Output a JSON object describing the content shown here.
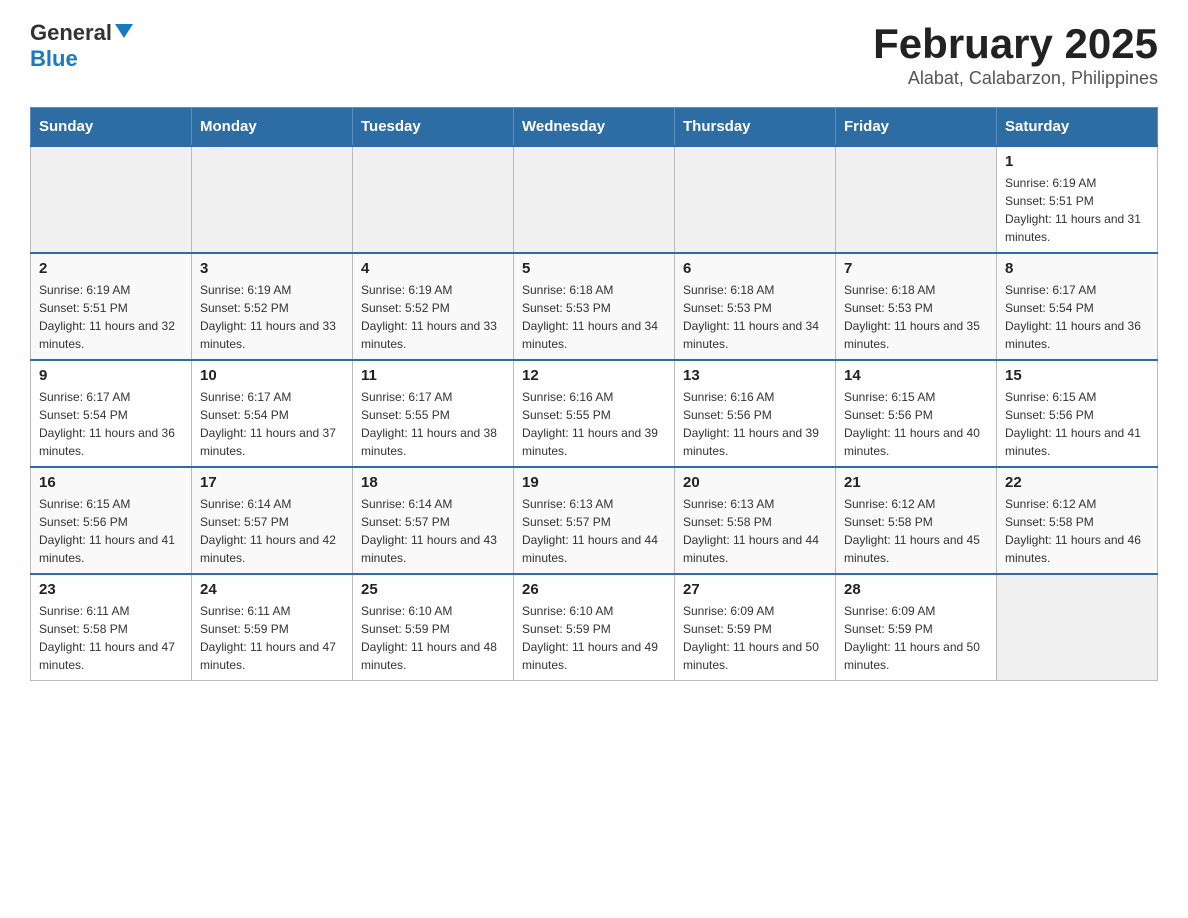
{
  "header": {
    "logo_general": "General",
    "logo_blue": "Blue",
    "main_title": "February 2025",
    "subtitle": "Alabat, Calabarzon, Philippines"
  },
  "days_of_week": [
    "Sunday",
    "Monday",
    "Tuesday",
    "Wednesday",
    "Thursday",
    "Friday",
    "Saturday"
  ],
  "weeks": [
    {
      "days": [
        {
          "empty": true
        },
        {
          "empty": true
        },
        {
          "empty": true
        },
        {
          "empty": true
        },
        {
          "empty": true
        },
        {
          "empty": true
        },
        {
          "date": 1,
          "sunrise": "6:19 AM",
          "sunset": "5:51 PM",
          "daylight": "11 hours and 31 minutes."
        }
      ]
    },
    {
      "days": [
        {
          "date": 2,
          "sunrise": "6:19 AM",
          "sunset": "5:51 PM",
          "daylight": "11 hours and 32 minutes."
        },
        {
          "date": 3,
          "sunrise": "6:19 AM",
          "sunset": "5:52 PM",
          "daylight": "11 hours and 33 minutes."
        },
        {
          "date": 4,
          "sunrise": "6:19 AM",
          "sunset": "5:52 PM",
          "daylight": "11 hours and 33 minutes."
        },
        {
          "date": 5,
          "sunrise": "6:18 AM",
          "sunset": "5:53 PM",
          "daylight": "11 hours and 34 minutes."
        },
        {
          "date": 6,
          "sunrise": "6:18 AM",
          "sunset": "5:53 PM",
          "daylight": "11 hours and 34 minutes."
        },
        {
          "date": 7,
          "sunrise": "6:18 AM",
          "sunset": "5:53 PM",
          "daylight": "11 hours and 35 minutes."
        },
        {
          "date": 8,
          "sunrise": "6:17 AM",
          "sunset": "5:54 PM",
          "daylight": "11 hours and 36 minutes."
        }
      ]
    },
    {
      "days": [
        {
          "date": 9,
          "sunrise": "6:17 AM",
          "sunset": "5:54 PM",
          "daylight": "11 hours and 36 minutes."
        },
        {
          "date": 10,
          "sunrise": "6:17 AM",
          "sunset": "5:54 PM",
          "daylight": "11 hours and 37 minutes."
        },
        {
          "date": 11,
          "sunrise": "6:17 AM",
          "sunset": "5:55 PM",
          "daylight": "11 hours and 38 minutes."
        },
        {
          "date": 12,
          "sunrise": "6:16 AM",
          "sunset": "5:55 PM",
          "daylight": "11 hours and 39 minutes."
        },
        {
          "date": 13,
          "sunrise": "6:16 AM",
          "sunset": "5:56 PM",
          "daylight": "11 hours and 39 minutes."
        },
        {
          "date": 14,
          "sunrise": "6:15 AM",
          "sunset": "5:56 PM",
          "daylight": "11 hours and 40 minutes."
        },
        {
          "date": 15,
          "sunrise": "6:15 AM",
          "sunset": "5:56 PM",
          "daylight": "11 hours and 41 minutes."
        }
      ]
    },
    {
      "days": [
        {
          "date": 16,
          "sunrise": "6:15 AM",
          "sunset": "5:56 PM",
          "daylight": "11 hours and 41 minutes."
        },
        {
          "date": 17,
          "sunrise": "6:14 AM",
          "sunset": "5:57 PM",
          "daylight": "11 hours and 42 minutes."
        },
        {
          "date": 18,
          "sunrise": "6:14 AM",
          "sunset": "5:57 PM",
          "daylight": "11 hours and 43 minutes."
        },
        {
          "date": 19,
          "sunrise": "6:13 AM",
          "sunset": "5:57 PM",
          "daylight": "11 hours and 44 minutes."
        },
        {
          "date": 20,
          "sunrise": "6:13 AM",
          "sunset": "5:58 PM",
          "daylight": "11 hours and 44 minutes."
        },
        {
          "date": 21,
          "sunrise": "6:12 AM",
          "sunset": "5:58 PM",
          "daylight": "11 hours and 45 minutes."
        },
        {
          "date": 22,
          "sunrise": "6:12 AM",
          "sunset": "5:58 PM",
          "daylight": "11 hours and 46 minutes."
        }
      ]
    },
    {
      "days": [
        {
          "date": 23,
          "sunrise": "6:11 AM",
          "sunset": "5:58 PM",
          "daylight": "11 hours and 47 minutes."
        },
        {
          "date": 24,
          "sunrise": "6:11 AM",
          "sunset": "5:59 PM",
          "daylight": "11 hours and 47 minutes."
        },
        {
          "date": 25,
          "sunrise": "6:10 AM",
          "sunset": "5:59 PM",
          "daylight": "11 hours and 48 minutes."
        },
        {
          "date": 26,
          "sunrise": "6:10 AM",
          "sunset": "5:59 PM",
          "daylight": "11 hours and 49 minutes."
        },
        {
          "date": 27,
          "sunrise": "6:09 AM",
          "sunset": "5:59 PM",
          "daylight": "11 hours and 50 minutes."
        },
        {
          "date": 28,
          "sunrise": "6:09 AM",
          "sunset": "5:59 PM",
          "daylight": "11 hours and 50 minutes."
        },
        {
          "empty": true
        }
      ]
    }
  ],
  "labels": {
    "sunrise": "Sunrise:",
    "sunset": "Sunset:",
    "daylight": "Daylight:"
  }
}
